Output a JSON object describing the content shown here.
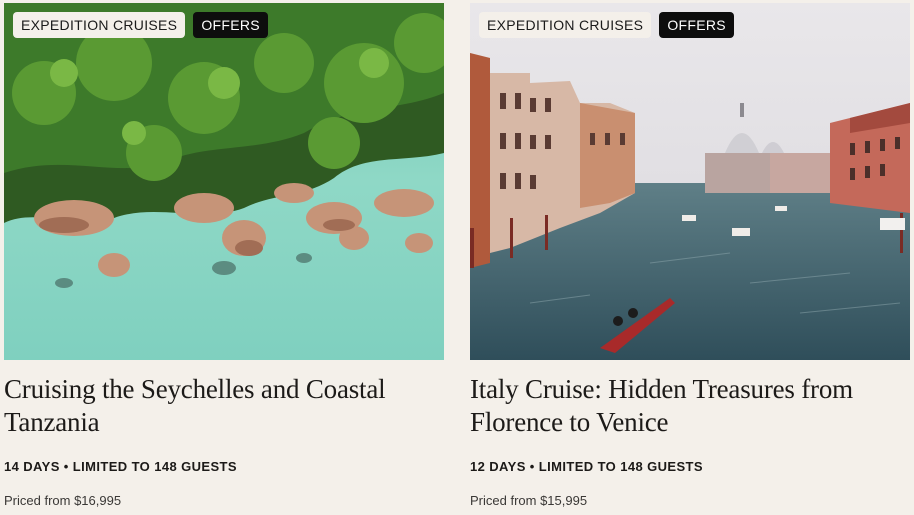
{
  "cards": [
    {
      "tags": [
        "EXPEDITION CRUISES",
        "OFFERS"
      ],
      "title": "Cruising the Seychelles and Coastal Tanzania",
      "meta": "14 DAYS • LIMITED TO 148 GUESTS",
      "price": "Priced from $16,995",
      "image": "aerial tropical coastline with palm trees and granite boulders"
    },
    {
      "tags": [
        "EXPEDITION CRUISES",
        "OFFERS"
      ],
      "title": "Italy Cruise: Hidden Treasures from Florence to Venice",
      "meta": "12 DAYS • LIMITED TO 148 GUESTS",
      "price": "Priced from $15,995",
      "image": "Venice Grand Canal with gondola and domed basilica"
    }
  ],
  "colors": {
    "background": "#f4f0ea",
    "tag_light": "#f4f0ea",
    "tag_dark": "#0d0d0d",
    "text": "#1c1a18"
  }
}
